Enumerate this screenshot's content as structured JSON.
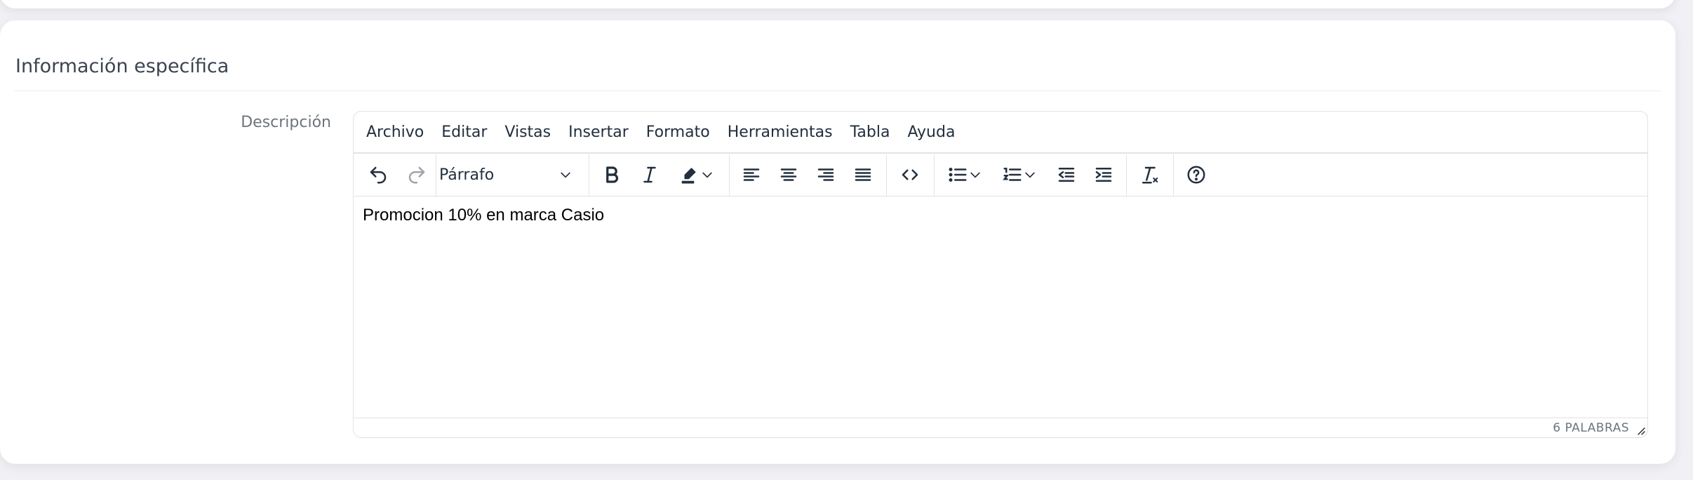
{
  "section": {
    "title": "Información específica"
  },
  "field": {
    "label": "Descripción"
  },
  "editor": {
    "menu": [
      "Archivo",
      "Editar",
      "Vistas",
      "Insertar",
      "Formato",
      "Herramientas",
      "Tabla",
      "Ayuda"
    ],
    "block_format": "Párrafo",
    "content": "Promocion 10% en marca Casio",
    "word_count": "6 PALABRAS"
  },
  "icons": {
    "toolbar": [
      "undo-icon",
      "redo-icon",
      "bold-icon",
      "italic-icon",
      "highlight-icon",
      "align-left-icon",
      "align-center-icon",
      "align-right-icon",
      "align-justify-icon",
      "source-code-icon",
      "bullet-list-icon",
      "numbered-list-icon",
      "outdent-icon",
      "indent-icon",
      "clear-formatting-icon",
      "help-icon"
    ]
  },
  "colors": {
    "background": "#f1f1f5",
    "card": "#ffffff",
    "toolbar_icon": "#222f3e",
    "disabled_icon": "#a0a5ab"
  }
}
